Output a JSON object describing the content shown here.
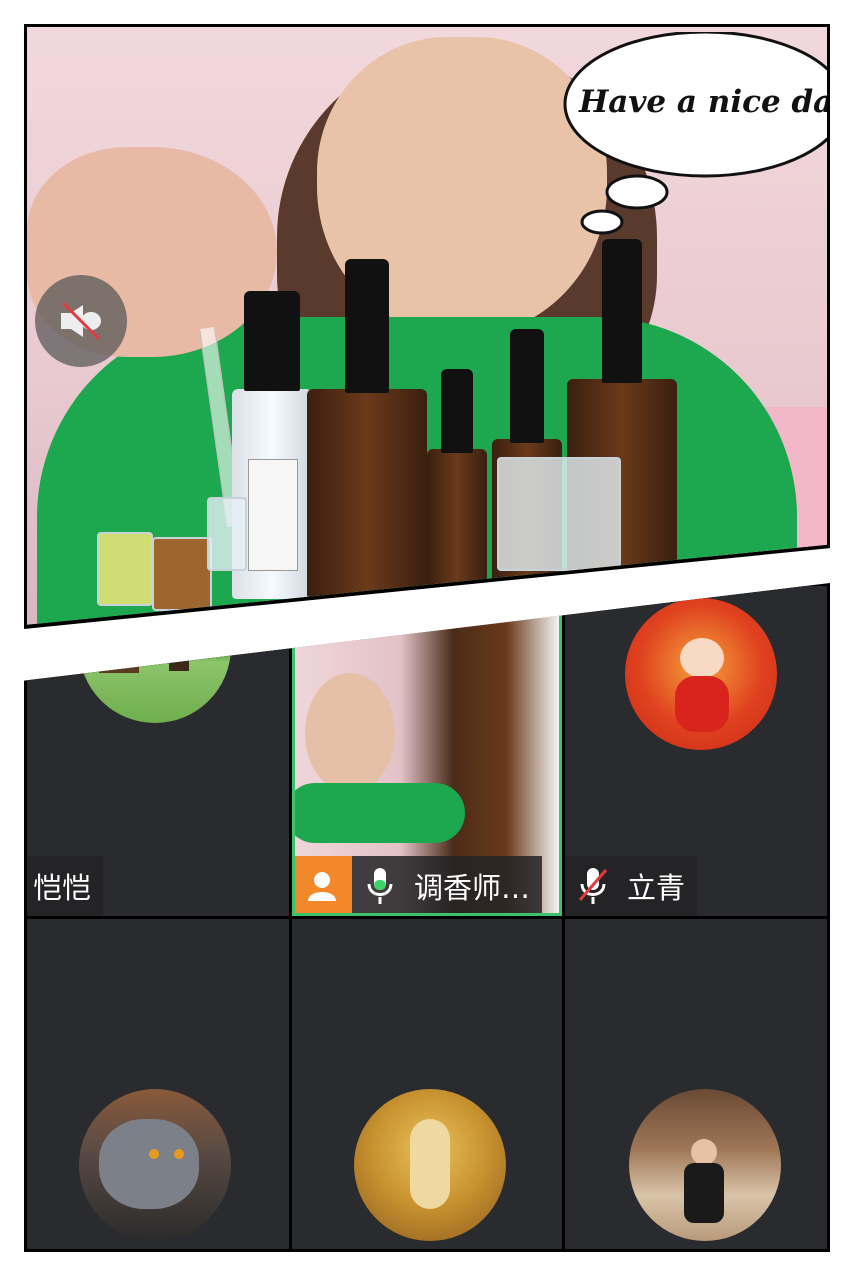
{
  "top_video": {
    "speech_bubble": "Have a nice day!",
    "camera_muted_icon": "speaker-muted-icon"
  },
  "participants": [
    {
      "name": "恺恺",
      "avatar": "park-landscape-avatar",
      "mic": "none"
    },
    {
      "name": "调香师…",
      "avatar": "video-feed",
      "mic": "active",
      "badge": "host-person-icon",
      "active_speaker": true
    },
    {
      "name": "立青",
      "avatar": "cartoon-child-avatar",
      "mic": "muted"
    },
    {
      "name": "",
      "avatar": "grey-cat-avatar",
      "mic": "none"
    },
    {
      "name": "",
      "avatar": "golden-mural-avatar",
      "mic": "none"
    },
    {
      "name": "",
      "avatar": "woman-in-hallway-avatar",
      "mic": "none"
    }
  ],
  "colors": {
    "tile_bg": "#2a2b2e",
    "active_border": "#3cc36a",
    "host_badge": "#f2882a",
    "mic_active": "#3fd26a",
    "mic_muted_slash": "#e23b3b"
  }
}
